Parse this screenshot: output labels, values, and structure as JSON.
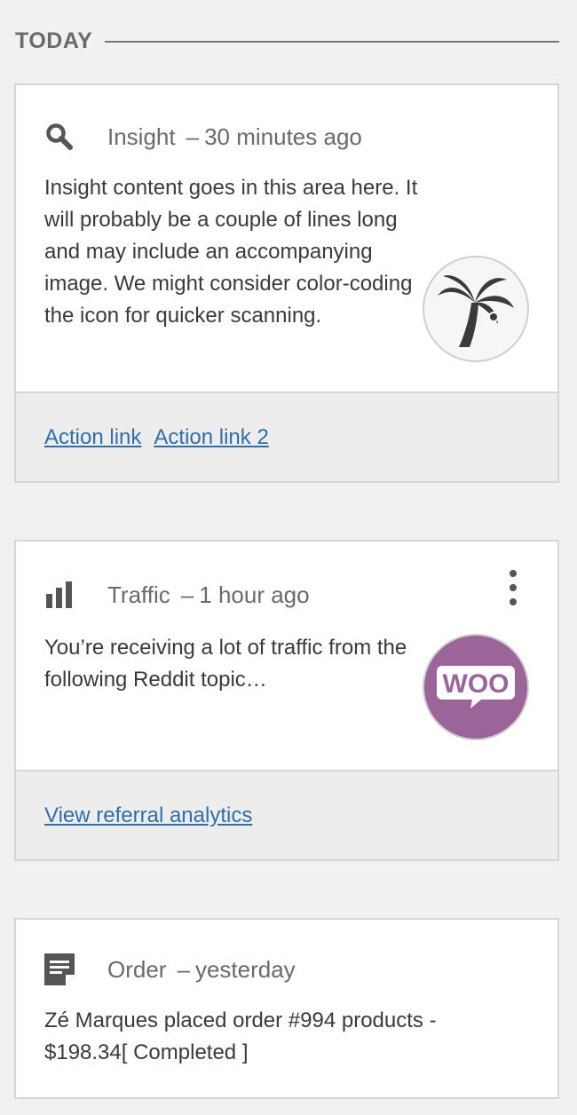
{
  "section": {
    "title": "TODAY"
  },
  "cards": [
    {
      "type": "Insight",
      "separator": "–",
      "time": "30 minutes ago",
      "icon": "search-icon",
      "text": "Insight content goes in this area here. It will probably be a couple of lines long and may include an accompanying image. We might consider color-coding the icon for quicker scanning.",
      "thumbnail": "palm-tree-logo",
      "actions": [
        "Action link",
        "Action link 2"
      ]
    },
    {
      "type": "Traffic",
      "separator": "–",
      "time": "1 hour ago",
      "icon": "bar-chart-icon",
      "text": "You’re receiving a lot of traffic from the following Reddit topic…",
      "thumbnail": "woo-logo",
      "thumbnail_text": "WOO",
      "actions": [
        "View referral analytics"
      ]
    },
    {
      "type": "Order",
      "separator": "–",
      "time": "yesterday",
      "icon": "note-icon",
      "text": "Zé Marques placed order #994 products - $198.34[ Completed ]"
    }
  ],
  "colors": {
    "link": "#2f6fa7",
    "woo_purple": "#9b6599",
    "icon_gray": "#555555"
  }
}
